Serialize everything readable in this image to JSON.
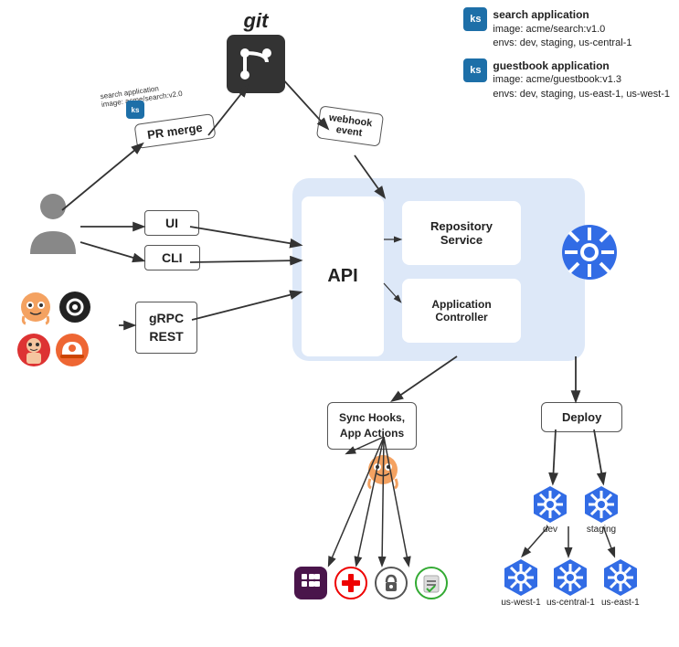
{
  "git": {
    "label": "git",
    "icon_desc": "git-branch-icon"
  },
  "apps": {
    "search": {
      "title": "search application",
      "line1": "image: acme/search:v1.0",
      "line2": "envs: dev, staging, us-central-1"
    },
    "guestbook": {
      "title": "guestbook application",
      "line1": "image: acme/guestbook:v1.3",
      "line2": "envs: dev, staging, us-east-1, us-west-1"
    }
  },
  "pr_merge": {
    "label": "PR merge",
    "commit_label": "search application\nimage: acme/search:v2.0"
  },
  "webhook_event": {
    "label": "webhook\nevent"
  },
  "ui_box": {
    "label": "UI"
  },
  "cli_box": {
    "label": "CLI"
  },
  "grpc_box": {
    "label": "gRPC\nREST"
  },
  "api_box": {
    "label": "API"
  },
  "repo_service": {
    "label": "Repository\nService"
  },
  "app_controller": {
    "label": "Application\nController"
  },
  "sync_hooks": {
    "label": "Sync Hooks,\nApp Actions"
  },
  "deploy_box": {
    "label": "Deploy"
  },
  "deploy_envs": {
    "top": [
      "dev",
      "staging"
    ],
    "bottom": [
      "us-west-1",
      "us-central-1",
      "us-east-1"
    ]
  },
  "colors": {
    "panel_bg": "#dde8f8",
    "k8s_blue": "#3970e4",
    "k8s_dark": "#326ce5",
    "box_border": "#555"
  }
}
